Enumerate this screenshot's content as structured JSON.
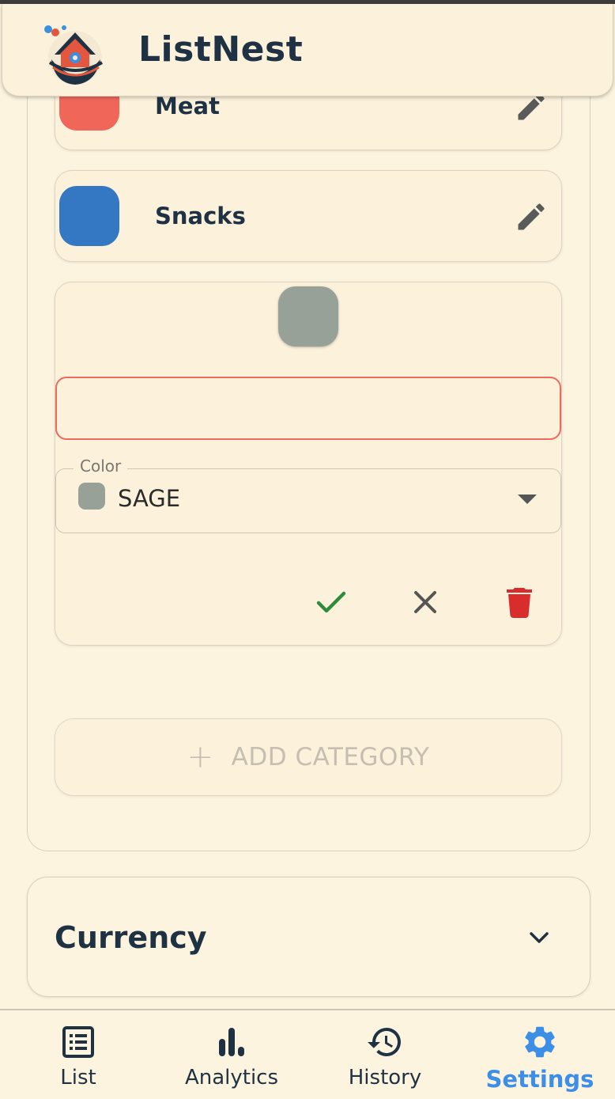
{
  "app": {
    "title": "ListNest",
    "logo": "nest-house-logo-icon"
  },
  "categories": [
    {
      "name": "Meat",
      "color": "#f0675a"
    },
    {
      "name": "Snacks",
      "color": "#3478c4"
    }
  ],
  "editor": {
    "name_value": "",
    "color_label": "Color",
    "color_value": "SAGE",
    "color_hex": "#97a197",
    "actions": [
      "check-icon",
      "close-icon",
      "trash-icon"
    ]
  },
  "add_button": {
    "label": "ADD CATEGORY",
    "icon": "plus-icon"
  },
  "currency": {
    "title": "Currency"
  },
  "nav": {
    "items": [
      {
        "label": "List",
        "icon": "list-icon"
      },
      {
        "label": "Analytics",
        "icon": "bar-chart-icon"
      },
      {
        "label": "History",
        "icon": "history-icon"
      },
      {
        "label": "Settings",
        "icon": "gear-icon"
      }
    ],
    "active": "Settings"
  },
  "colors": {
    "accent": "#3d8ee6",
    "confirm": "#2e8b3a",
    "delete": "#d92c2c",
    "error_border": "#ec6b5b"
  }
}
